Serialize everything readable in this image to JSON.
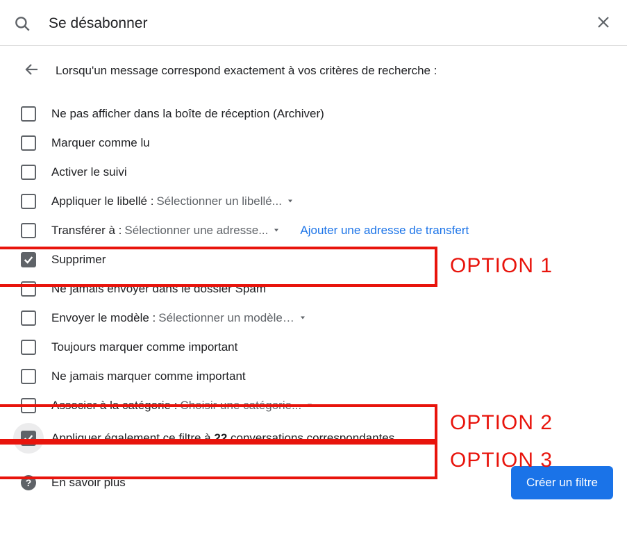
{
  "search": {
    "value": "Se désabonner"
  },
  "intro": "Lorsqu'un message correspond exactement à vos critères de recherche :",
  "options": {
    "archive": {
      "label": "Ne pas afficher dans la boîte de réception (Archiver)",
      "checked": false
    },
    "mark_read": {
      "label": "Marquer comme lu",
      "checked": false
    },
    "star": {
      "label": "Activer le suivi",
      "checked": false
    },
    "apply_label": {
      "label": "Appliquer le libellé :",
      "select": "Sélectionner un libellé...",
      "checked": false
    },
    "forward": {
      "label": "Transférer à :",
      "select": "Sélectionner une adresse...",
      "link": "Ajouter une adresse de transfert",
      "checked": false
    },
    "delete": {
      "label": "Supprimer",
      "checked": true
    },
    "never_spam": {
      "label": "Ne jamais envoyer dans le dossier Spam",
      "checked": false
    },
    "send_template": {
      "label": "Envoyer le modèle :",
      "select": "Sélectionner un modèle…",
      "checked": false
    },
    "always_important": {
      "label": "Toujours marquer comme important",
      "checked": false
    },
    "never_important": {
      "label": "Ne jamais marquer comme important",
      "checked": false
    },
    "categorize": {
      "label": "Associer à la catégorie :",
      "select": "Choisir une catégorie...",
      "checked": false
    },
    "apply_existing": {
      "prefix": "Appliquer également ce filtre à ",
      "count": "22",
      "suffix": " conversations correspondantes.",
      "checked": true
    }
  },
  "footer": {
    "learn_more": "En savoir plus",
    "create_button": "Créer un filtre"
  },
  "annotations": {
    "opt1": "OPTION 1",
    "opt2": "OPTION 2",
    "opt3": "OPTION 3"
  }
}
